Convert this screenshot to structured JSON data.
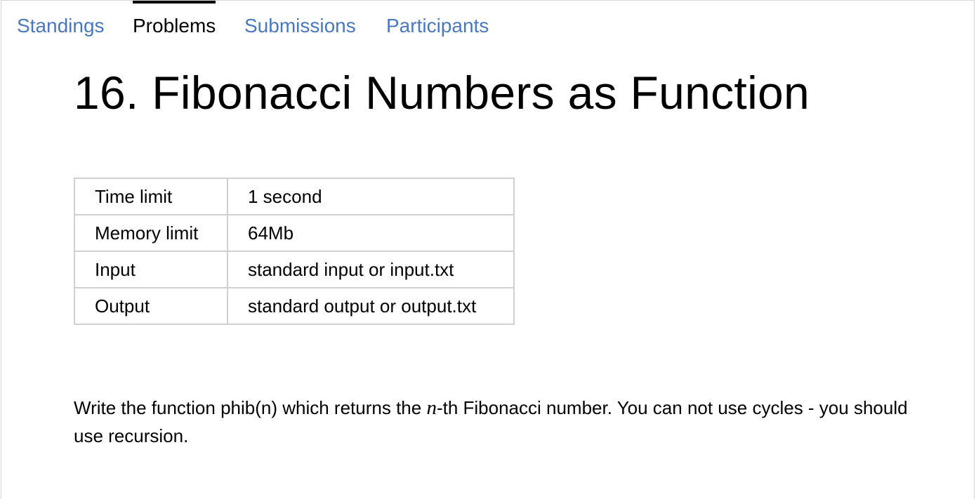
{
  "nav": {
    "tabs": [
      {
        "label": "Standings",
        "active": false
      },
      {
        "label": "Problems",
        "active": true
      },
      {
        "label": "Submissions",
        "active": false
      },
      {
        "label": "Participants",
        "active": false
      }
    ]
  },
  "problem": {
    "title": "16. Fibonacci Numbers as Function",
    "limits": [
      {
        "key": "Time limit",
        "value": "1 second"
      },
      {
        "key": "Memory limit",
        "value": "64Mb"
      },
      {
        "key": "Input",
        "value": "standard input or input.txt"
      },
      {
        "key": "Output",
        "value": "standard output or output.txt"
      }
    ],
    "statement": {
      "before": "Write the function phib(n) which returns the ",
      "var": "n",
      "after": "-th Fibonacci number. You can not use cycles - you should use recursion."
    }
  },
  "colors": {
    "link": "#4a78c0",
    "active_tab_bar": "#000000",
    "table_border": "#d0d0d0"
  }
}
